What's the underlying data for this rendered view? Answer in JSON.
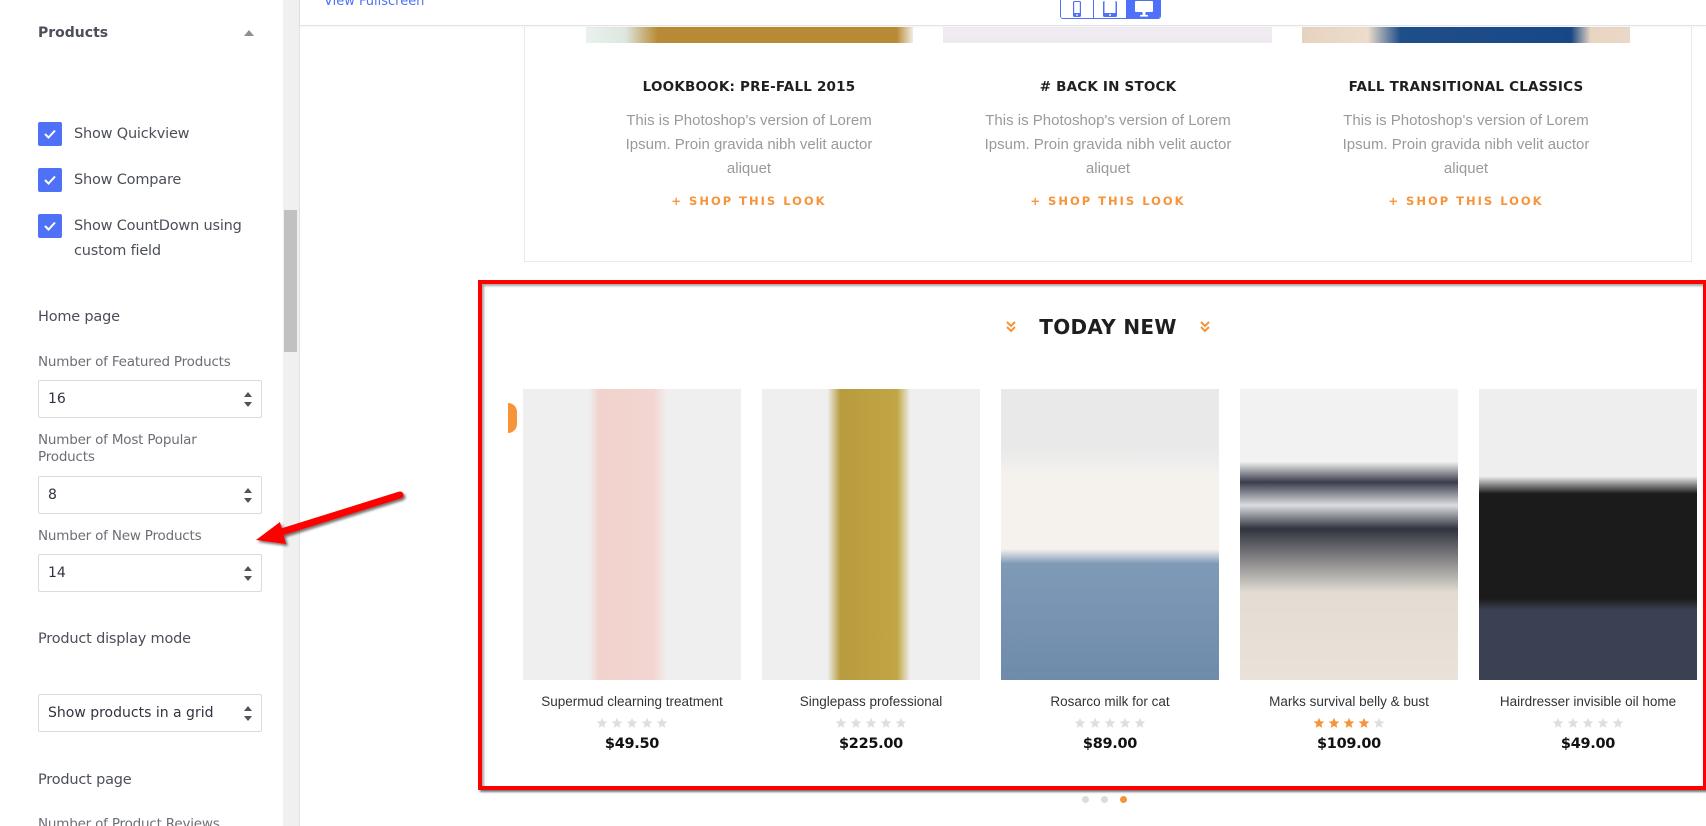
{
  "sidebar": {
    "section_title": "Products",
    "checkboxes": [
      {
        "label": "Show Quickview",
        "checked": true
      },
      {
        "label": "Show Compare",
        "checked": true
      },
      {
        "label": "Show CountDown using custom field",
        "line1": "Show CountDown using",
        "line2": "custom field",
        "checked": true
      }
    ],
    "home_page": {
      "heading": "Home page",
      "featured_label": "Number of Featured Products",
      "featured_value": "16",
      "popular_label_line1": "Number of Most Popular",
      "popular_label_line2": "Products",
      "popular_value": "8",
      "new_label": "Number of New Products",
      "new_value": "14"
    },
    "display_mode": {
      "heading": "Product display mode",
      "selected": "Show products in a grid"
    },
    "product_page": {
      "heading": "Product page",
      "reviews_label": "Number of Product Reviews"
    }
  },
  "topbar": {
    "view_fullscreen": "View Fullscreen",
    "devices": [
      {
        "name": "mobile",
        "active": false
      },
      {
        "name": "tablet",
        "active": false
      },
      {
        "name": "desktop",
        "active": true
      }
    ]
  },
  "lookbook": [
    {
      "title": "LOOKBOOK: PRE-FALL 2015",
      "text": "This is Photoshop's version of Lorem Ipsum. Proin gravida nibh velit auctor aliquet",
      "link": "+ SHOP THIS LOOK"
    },
    {
      "title": "# BACK IN STOCK",
      "text": "This is Photoshop's version of Lorem Ipsum. Proin gravida nibh velit auctor aliquet",
      "link": "+ SHOP THIS LOOK"
    },
    {
      "title": "FALL TRANSITIONAL CLASSICS",
      "text": "This is Photoshop's version of Lorem Ipsum. Proin gravida nibh velit auctor aliquet",
      "link": "+ SHOP THIS LOOK"
    }
  ],
  "today_new": {
    "heading": "TODAY NEW",
    "products": [
      {
        "name": "Supermud clearning treatment",
        "rating": 0,
        "price": "$49.50"
      },
      {
        "name": "Singlepass professional",
        "rating": 0,
        "price": "$225.00"
      },
      {
        "name": "Rosarco milk for cat",
        "rating": 0,
        "price": "$89.00"
      },
      {
        "name": "Marks survival belly & bust",
        "rating": 4,
        "price": "$109.00"
      },
      {
        "name": "Hairdresser invisible oil home",
        "rating": 0,
        "price": "$49.00"
      }
    ],
    "pagination": {
      "pages": 3,
      "active": 3
    }
  },
  "colors": {
    "accent_blue": "#4f71f7",
    "accent_orange": "#f7943a",
    "annotation_red": "#ff0000"
  }
}
